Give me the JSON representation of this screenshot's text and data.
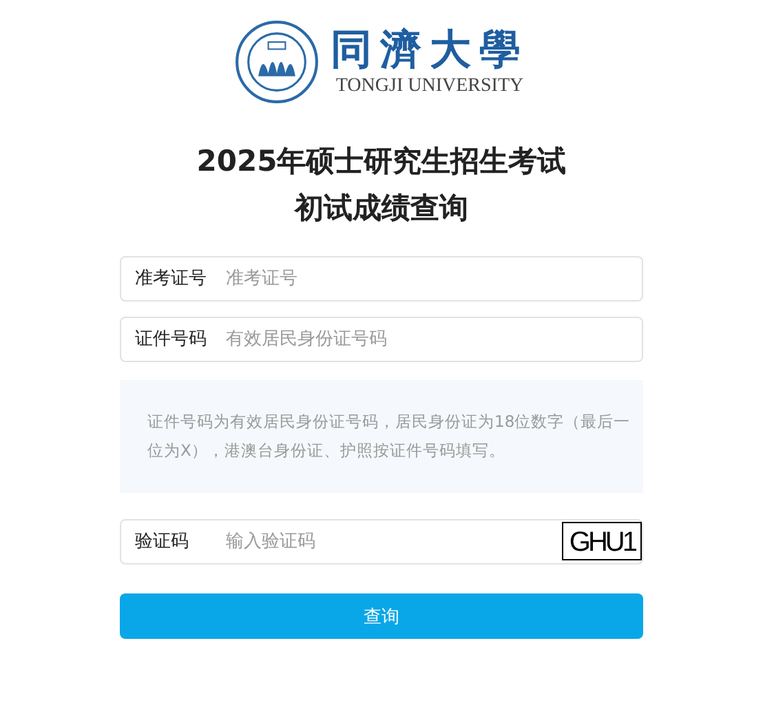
{
  "logo": {
    "name_zh": "同濟大學",
    "name_en": "TONGJI UNIVERSITY"
  },
  "title": [
    "2025年硕士研究生招生考试",
    "初试成绩查询"
  ],
  "fields": [
    {
      "label": "准考证号",
      "placeholder": "准考证号"
    },
    {
      "label": "证件号码",
      "placeholder": "有效居民身份证号码"
    }
  ],
  "note": "证件号码为有效居民身份证号码，居民身份证为18位数字（最后一位为X），港澳台身份证、护照按证件号码填写。",
  "captcha": {
    "label": "验证码",
    "placeholder": "输入验证码",
    "code": "GHU1"
  },
  "submit": "查询"
}
